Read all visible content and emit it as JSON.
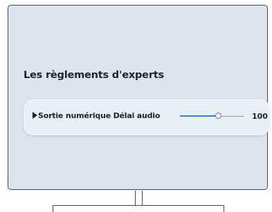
{
  "menu": {
    "section_title": "Les règlements d'experts",
    "setting": {
      "label": "Sortie numérique Délai audio",
      "value_text": "100",
      "slider_fraction": 0.61
    }
  },
  "colors": {
    "screen_background": "#dce4ef",
    "row_background": "#e9eff7",
    "accent": "#2d7be3",
    "text": "#1c2430"
  },
  "icons": {
    "row_arrow": "right-triangle-pointer-icon"
  }
}
